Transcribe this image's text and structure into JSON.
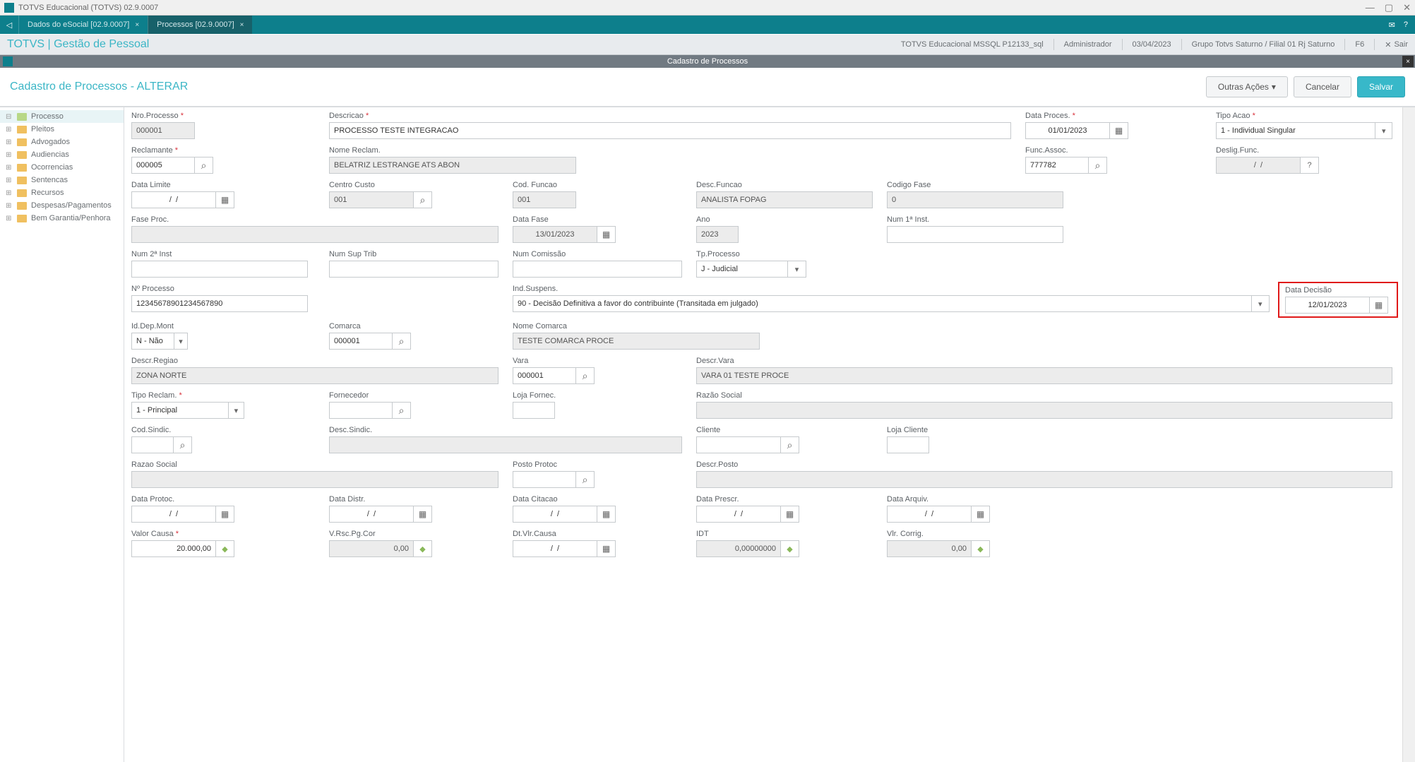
{
  "titlebar": {
    "title": "TOTVS Educacional (TOTVS) 02.9.0007"
  },
  "tabs": {
    "t1": "Dados do eSocial [02.9.0007]",
    "t2": "Processos [02.9.0007]"
  },
  "appheader": {
    "title": "TOTVS | Gestão de Pessoal",
    "env": "TOTVS Educacional MSSQL P12133_sql",
    "user": "Administrador",
    "date": "03/04/2023",
    "branch": "Grupo Totvs Saturno / Filial 01 Rj Saturno",
    "key": "F6",
    "exit": "Sair"
  },
  "subwindow": {
    "title": "Cadastro de Processos"
  },
  "actionbar": {
    "title": "Cadastro de Processos - ALTERAR",
    "outras": "Outras Ações",
    "cancelar": "Cancelar",
    "salvar": "Salvar"
  },
  "tree": {
    "n0": "Processo",
    "n1": "Pleitos",
    "n2": "Advogados",
    "n3": "Audiencias",
    "n4": "Ocorrencias",
    "n5": "Sentencas",
    "n6": "Recursos",
    "n7": "Despesas/Pagamentos",
    "n8": "Bem Garantia/Penhora"
  },
  "labels": {
    "nroProcesso": "Nro.Processo",
    "descricao": "Descricao",
    "dataProces": "Data Proces.",
    "tipoAcao": "Tipo Acao",
    "reclamante": "Reclamante",
    "nomeReclam": "Nome Reclam.",
    "funcAssoc": "Func.Assoc.",
    "desligFunc": "Deslig.Func.",
    "dataLimite": "Data Limite",
    "centroCusto": "Centro Custo",
    "codFuncao": "Cod. Funcao",
    "descFuncao": "Desc.Funcao",
    "codigoFase": "Codigo Fase",
    "faseProc": "Fase Proc.",
    "dataFase": "Data Fase",
    "ano": "Ano",
    "num1Inst": "Num 1ª Inst.",
    "num2Inst": "Num 2ª Inst",
    "numSupTrib": "Num Sup Trib",
    "numComissao": "Num Comissão",
    "tpProcesso": "Tp.Processo",
    "nProcesso": "Nº Processo",
    "indSuspens": "Ind.Suspens.",
    "dataDecisao": "Data Decisão",
    "idDepMont": "Id.Dep.Mont",
    "comarca": "Comarca",
    "nomeComarca": "Nome Comarca",
    "descrRegiao": "Descr.Regiao",
    "vara": "Vara",
    "descrVara": "Descr.Vara",
    "tipoReclam": "Tipo Reclam.",
    "fornecedor": "Fornecedor",
    "lojaFornec": "Loja Fornec.",
    "razaoSocial": "Razão Social",
    "codSindic": "Cod.Sindic.",
    "descSindic": "Desc.Sindic.",
    "cliente": "Cliente",
    "lojaCliente": "Loja Cliente",
    "razaoSocial2": "Razao Social",
    "postoProtoc": "Posto Protoc",
    "descrPosto": "Descr.Posto",
    "dataProtoc": "Data Protoc.",
    "dataDistr": "Data Distr.",
    "dataCitacao": "Data Citacao",
    "dataPrescr": "Data Prescr.",
    "dataArquiv": "Data Arquiv.",
    "valorCausa": "Valor Causa",
    "vrscPgCor": "V.Rsc.Pg.Cor",
    "dtVlrCausa": "Dt.Vlr.Causa",
    "idt": "IDT",
    "vlrCorrig": "Vlr. Corrig."
  },
  "values": {
    "nroProcesso": "000001",
    "descricao": "PROCESSO TESTE INTEGRACAO",
    "dataProces": "01/01/2023",
    "tipoAcao": "1 - Individual Singular",
    "reclamante": "000005",
    "nomeReclam": "BELATRIZ LESTRANGE ATS ABON",
    "funcAssoc": "777782",
    "desligFunc": "/  /",
    "dataLimite": "/  /",
    "centroCusto": "001",
    "codFuncao": "001",
    "descFuncao": "ANALISTA FOPAG",
    "codigoFase": "0",
    "dataFase": "13/01/2023",
    "ano": "2023",
    "tpProcesso": "J - Judicial",
    "nProcesso": "12345678901234567890",
    "indSuspens": "90 - Decisão Definitiva a favor do contribuinte (Transitada em julgado)",
    "dataDecisao": "12/01/2023",
    "idDepMont": "N - Não",
    "comarca": "000001",
    "nomeComarca": "TESTE COMARCA PROCE",
    "descrRegiao": "ZONA NORTE",
    "vara": "000001",
    "descrVara": "VARA 01 TESTE PROCE",
    "tipoReclam": "1 - Principal",
    "dataProtoc": "/  /",
    "dataDistr": "/  /",
    "dataCitacao": "/  /",
    "dataPrescr": "/  /",
    "dataArquiv": "/  /",
    "valorCausa": "20.000,00",
    "vrscPgCor": "0,00",
    "dtVlrCausa": "/  /",
    "idt": "0,00000000",
    "vlrCorrig": "0,00",
    "question": "?"
  }
}
